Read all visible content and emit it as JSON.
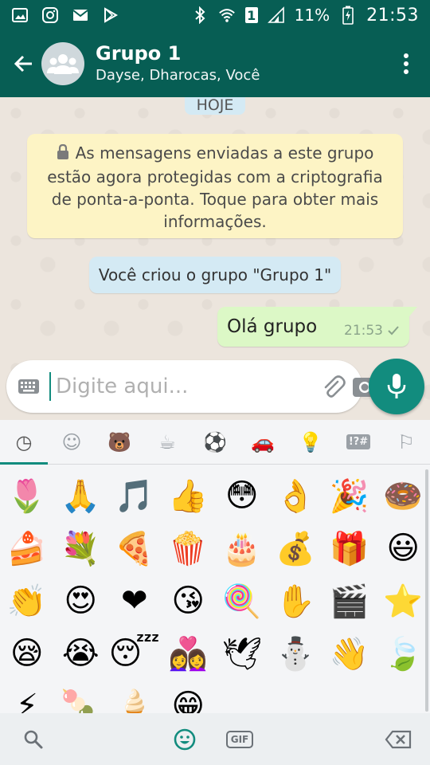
{
  "status_bar": {
    "battery": "11%",
    "time": "21:53",
    "sim": "1",
    "icons": [
      "gallery-icon",
      "instagram-icon",
      "mail-icon",
      "play-store-icon",
      "bluetooth-icon",
      "wifi-icon",
      "signal-icon",
      "battery-icon"
    ]
  },
  "header": {
    "title": "Grupo 1",
    "subtitle": "Dayse, Dharocas, Você",
    "back_icon": "arrow-left-icon",
    "avatar_icon": "group-avatar-icon",
    "menu_icon": "more-vert-icon"
  },
  "chat": {
    "date_chip": "HOJE",
    "encryption_notice": "As mensagens enviadas a este grupo estão agora protegidas com a criptografia de ponta-a-ponta. Toque para obter mais informações.",
    "system_message": "Você criou o grupo \"Grupo 1\"",
    "messages": [
      {
        "text": "Olá grupo",
        "time": "21:53",
        "status": "sent"
      }
    ]
  },
  "composer": {
    "placeholder": "Digite aqui...",
    "keyboard_icon": "keyboard-icon",
    "attach_icon": "paperclip-icon",
    "camera_icon": "camera-icon",
    "mic_icon": "mic-icon"
  },
  "emoji_panel": {
    "tabs": [
      {
        "name": "recent",
        "icon": "clock-icon",
        "glyph": "◷"
      },
      {
        "name": "smileys",
        "icon": "smiley-icon",
        "glyph": "☺"
      },
      {
        "name": "animals",
        "icon": "bear-icon",
        "glyph": "🐻"
      },
      {
        "name": "food",
        "icon": "cup-icon",
        "glyph": "☕"
      },
      {
        "name": "activity",
        "icon": "soccer-ball-icon",
        "glyph": "⚽"
      },
      {
        "name": "travel",
        "icon": "car-icon",
        "glyph": "🚗"
      },
      {
        "name": "objects",
        "icon": "lightbulb-icon",
        "glyph": "💡"
      },
      {
        "name": "symbols",
        "icon": "symbols-icon",
        "glyph": "!?#"
      },
      {
        "name": "flags",
        "icon": "flag-icon",
        "glyph": "⚐"
      }
    ],
    "emojis": [
      "🌷",
      "🙏",
      "🎵",
      "👍",
      "😳",
      "👌",
      "🎉",
      "🍩",
      "🍰",
      "💐",
      "🍕",
      "🍿",
      "🎂",
      "💰",
      "🎁",
      "😃",
      "👏",
      "😍",
      "❤",
      "😘",
      "🍭",
      "✋",
      "🎬",
      "⭐",
      "😪",
      "😭",
      "😴",
      "👩‍❤️‍👩",
      "🕊",
      "⛄",
      "👋",
      "🍃",
      "⚡",
      "🍡",
      "🍦",
      "😁"
    ],
    "bottom": {
      "search_icon": "search-icon",
      "emoji_icon": "emoji-icon",
      "gif_label": "GIF",
      "backspace_icon": "backspace-icon"
    }
  },
  "colors": {
    "header": "#075e54",
    "accent": "#128c7e",
    "outgoing_bubble": "#dcf8c6",
    "notice_bg": "#fdf4c5",
    "system_bg": "#d4eaf4",
    "chat_bg": "#ece5dd"
  }
}
